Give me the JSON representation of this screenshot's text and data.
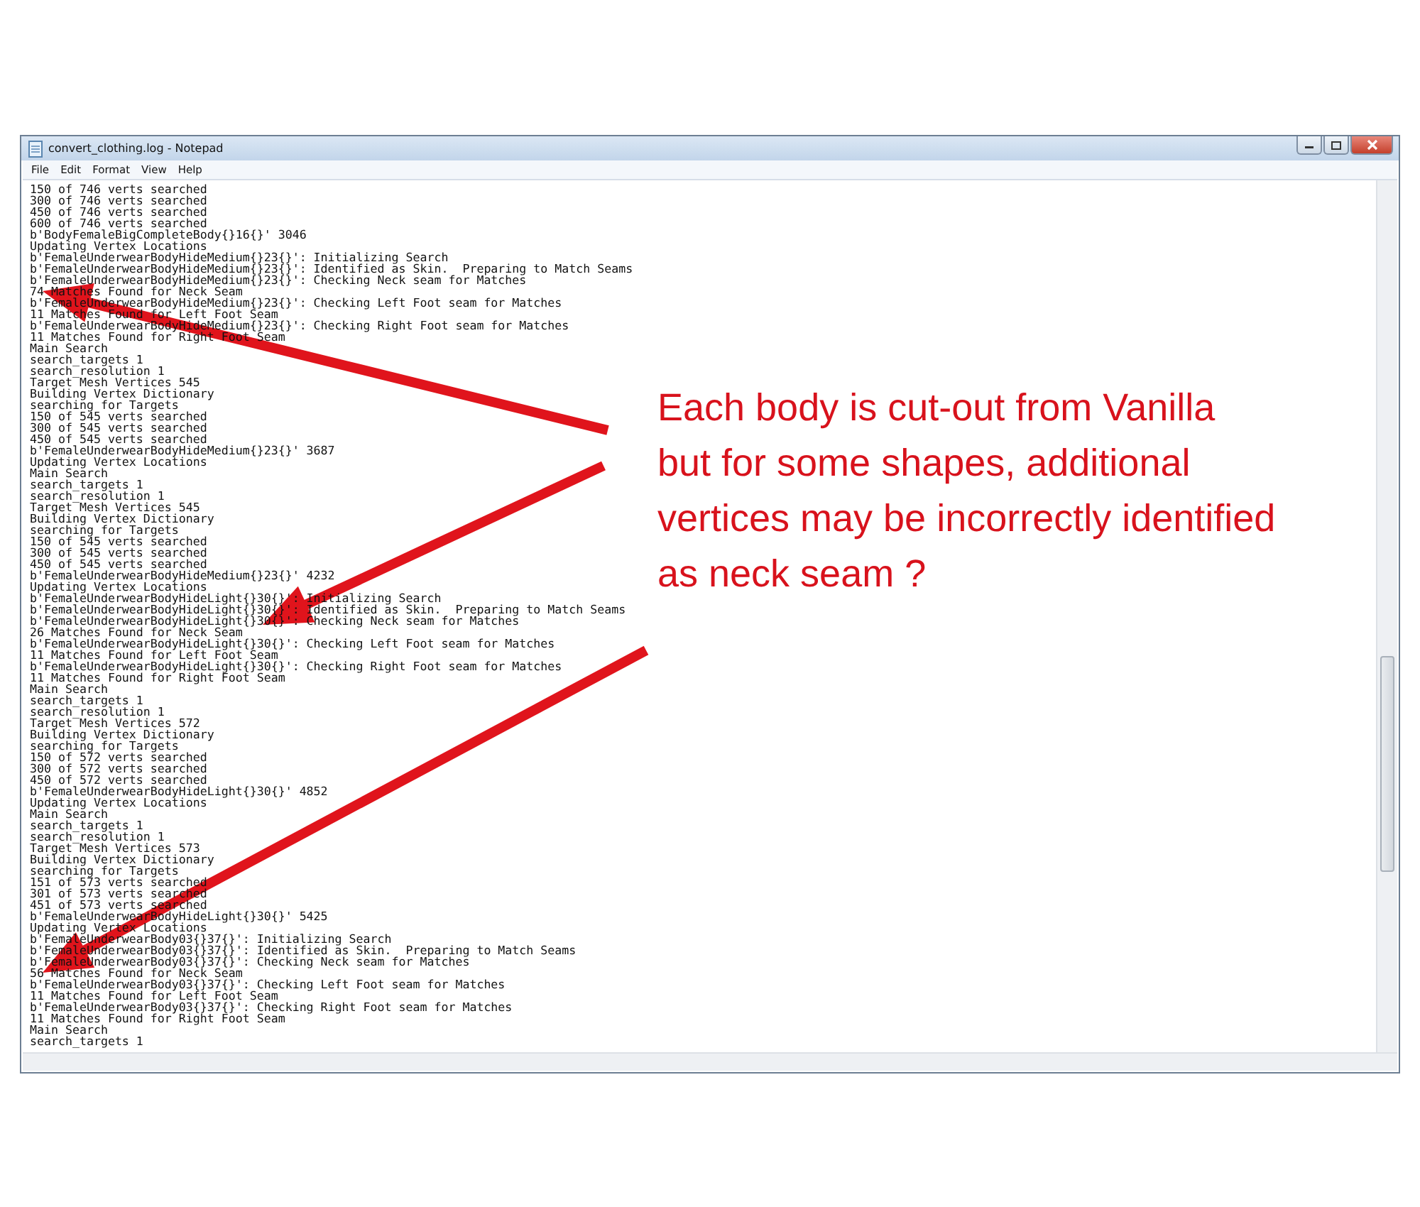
{
  "window": {
    "title": "convert_clothing.log - Notepad"
  },
  "menu": [
    "File",
    "Edit",
    "Format",
    "View",
    "Help"
  ],
  "editor": {
    "lines": [
      "150 of 746 verts searched",
      "300 of 746 verts searched",
      "450 of 746 verts searched",
      "600 of 746 verts searched",
      "b'BodyFemaleBigCompleteBody{}16{}' 3046",
      "Updating Vertex Locations",
      "b'FemaleUnderwearBodyHideMedium{}23{}': Initializing Search",
      "b'FemaleUnderwearBodyHideMedium{}23{}': Identified as Skin.  Preparing to Match Seams",
      "b'FemaleUnderwearBodyHideMedium{}23{}': Checking Neck seam for Matches",
      "74 Matches Found for Neck Seam",
      "b'FemaleUnderwearBodyHideMedium{}23{}': Checking Left Foot seam for Matches",
      "11 Matches Found for Left Foot Seam",
      "b'FemaleUnderwearBodyHideMedium{}23{}': Checking Right Foot seam for Matches",
      "11 Matches Found for Right Foot Seam",
      "Main Search",
      "search_targets 1",
      "search_resolution 1",
      "Target Mesh Vertices 545",
      "Building Vertex Dictionary",
      "searching for Targets",
      "150 of 545 verts searched",
      "300 of 545 verts searched",
      "450 of 545 verts searched",
      "b'FemaleUnderwearBodyHideMedium{}23{}' 3687",
      "Updating Vertex Locations",
      "Main Search",
      "search_targets 1",
      "search_resolution 1",
      "Target Mesh Vertices 545",
      "Building Vertex Dictionary",
      "searching for Targets",
      "150 of 545 verts searched",
      "300 of 545 verts searched",
      "450 of 545 verts searched",
      "b'FemaleUnderwearBodyHideMedium{}23{}' 4232",
      "Updating Vertex Locations",
      "b'FemaleUnderwearBodyHideLight{}30{}': Initializing Search",
      "b'FemaleUnderwearBodyHideLight{}30{}': Identified as Skin.  Preparing to Match Seams",
      "b'FemaleUnderwearBodyHideLight{}30{}': Checking Neck seam for Matches",
      "26 Matches Found for Neck Seam",
      "b'FemaleUnderwearBodyHideLight{}30{}': Checking Left Foot seam for Matches",
      "11 Matches Found for Left Foot Seam",
      "b'FemaleUnderwearBodyHideLight{}30{}': Checking Right Foot seam for Matches",
      "11 Matches Found for Right Foot Seam",
      "Main Search",
      "search_targets 1",
      "search_resolution 1",
      "Target Mesh Vertices 572",
      "Building Vertex Dictionary",
      "searching for Targets",
      "150 of 572 verts searched",
      "300 of 572 verts searched",
      "450 of 572 verts searched",
      "b'FemaleUnderwearBodyHideLight{}30{}' 4852",
      "Updating Vertex Locations",
      "Main Search",
      "search_targets 1",
      "search_resolution 1",
      "Target Mesh Vertices 573",
      "Building Vertex Dictionary",
      "searching for Targets",
      "151 of 573 verts searched",
      "301 of 573 verts searched",
      "451 of 573 verts searched",
      "b'FemaleUnderwearBodyHideLight{}30{}' 5425",
      "Updating Vertex Locations",
      "b'FemaleUnderwearBody03{}37{}': Initializing Search",
      "b'FemaleUnderwearBody03{}37{}': Identified as Skin.  Preparing to Match Seams",
      "b'FemaleUnderwearBody03{}37{}': Checking Neck seam for Matches",
      "56 Matches Found for Neck Seam",
      "b'FemaleUnderwearBody03{}37{}': Checking Left Foot seam for Matches",
      "11 Matches Found for Left Foot Seam",
      "b'FemaleUnderwearBody03{}37{}': Checking Right Foot seam for Matches",
      "11 Matches Found for Right Foot Seam",
      "Main Search",
      "search_targets 1"
    ]
  },
  "annotation": {
    "lines": [
      "Each body is cut-out from Vanilla",
      "but for some shapes, additional",
      "vertices may be incorrectly identified",
      "as neck seam ?"
    ]
  }
}
